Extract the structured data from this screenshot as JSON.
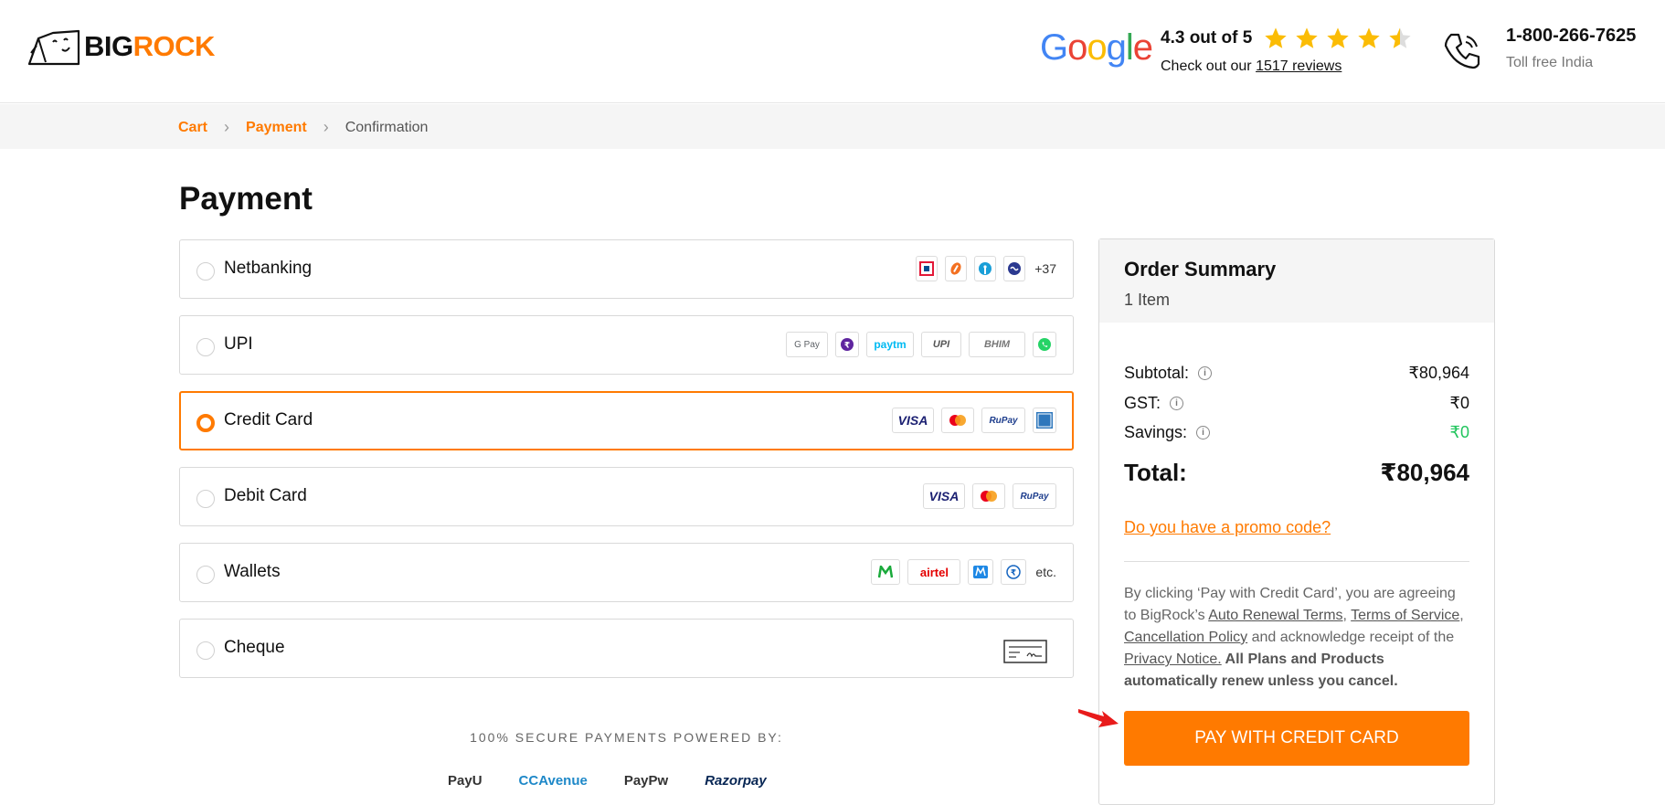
{
  "brand": {
    "logo_big": "BIG",
    "logo_rock": "ROCK"
  },
  "header": {
    "google_word": [
      "G",
      "o",
      "o",
      "g",
      "l",
      "e"
    ],
    "rating_text": "4.3 out of 5",
    "reviews_prefix": "Check out our ",
    "reviews_link": "1517 reviews",
    "phone_number": "1-800-266-7625",
    "phone_sub": "Toll free India"
  },
  "breadcrumb": {
    "cart": "Cart",
    "payment": "Payment",
    "confirmation": "Confirmation"
  },
  "page": {
    "title": "Payment"
  },
  "methods": [
    {
      "label": "Netbanking",
      "more": "+37"
    },
    {
      "label": "UPI"
    },
    {
      "label": "Credit Card"
    },
    {
      "label": "Debit Card"
    },
    {
      "label": "Wallets",
      "more": "etc."
    },
    {
      "label": "Cheque"
    }
  ],
  "logos": {
    "upi": [
      "G Pay",
      "paytm",
      "UPI",
      "BHIM"
    ],
    "cards": [
      "VISA",
      "RuPay"
    ],
    "wallets": [
      "airtel"
    ]
  },
  "secure": {
    "title": "100% SECURE PAYMENTS POWERED BY:",
    "gateways": [
      "PayU",
      "CCAvenue",
      "PayPw",
      "Razorpay"
    ]
  },
  "summary": {
    "title": "Order Summary",
    "items": "1 Item",
    "subtotal_label": "Subtotal:",
    "subtotal_value": "₹80,964",
    "gst_label": "GST:",
    "gst_value": "₹0",
    "savings_label": "Savings:",
    "savings_value": "₹0",
    "total_label": "Total:",
    "total_value": "₹80,964",
    "promo": "Do you have a promo code?",
    "legal_1": "By clicking ‘Pay with Credit Card’, you are agreeing to BigRock’s ",
    "auto_renewal": "Auto Renewal Terms",
    "comma1": ", ",
    "terms": "Terms of Service",
    "comma2": ", ",
    "cancellation": "Cancellation Policy",
    "legal_2": " and acknowledge receipt of the ",
    "privacy": "Privacy Notice.",
    "legal_bold": " All Plans and Products automatically renew unless you cancel.",
    "pay_button": "PAY WITH CREDIT CARD"
  },
  "colors": {
    "accent": "#ff7a00",
    "savings": "#22c55e",
    "star": "#fbbc05"
  },
  "rating_value": 4.3
}
